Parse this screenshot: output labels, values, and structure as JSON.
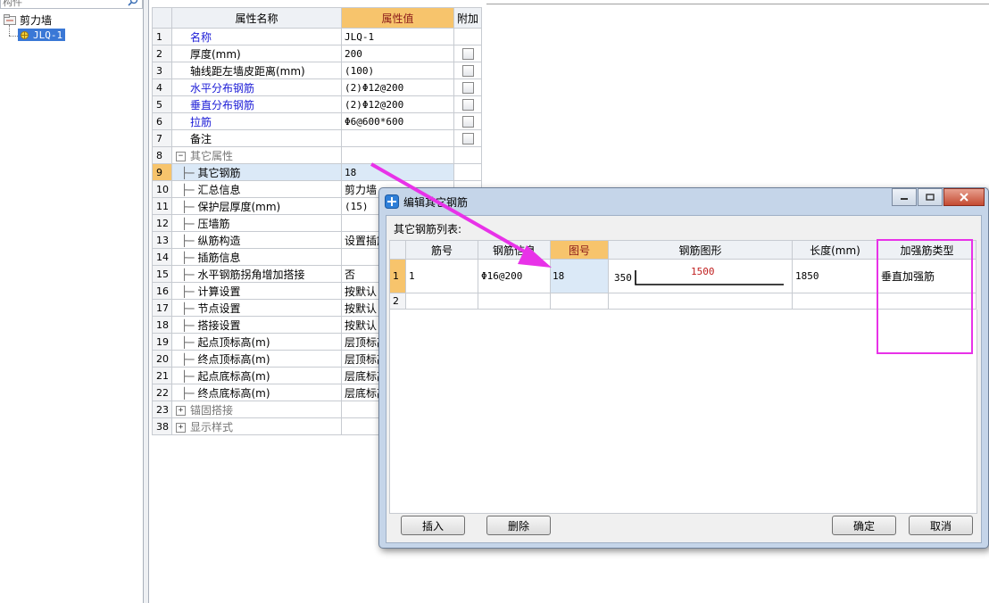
{
  "search": {
    "placeholder": "构件"
  },
  "tree": {
    "root_label": "剪力墙",
    "child_label": "JLQ-1"
  },
  "property_grid": {
    "headers": {
      "name": "属性名称",
      "value": "属性值",
      "add": "附加"
    },
    "rows": [
      {
        "num": "1",
        "name": "名称",
        "value": "JLQ-1",
        "blue": true,
        "checkbox": false
      },
      {
        "num": "2",
        "name": "厚度(mm)",
        "value": "200",
        "blue": false,
        "checkbox": true
      },
      {
        "num": "3",
        "name": "轴线距左墙皮距离(mm)",
        "value": "(100)",
        "blue": false,
        "checkbox": true
      },
      {
        "num": "4",
        "name": "水平分布钢筋",
        "value": "(2)Φ12@200",
        "blue": true,
        "checkbox": true
      },
      {
        "num": "5",
        "name": "垂直分布钢筋",
        "value": "(2)Φ12@200",
        "blue": true,
        "checkbox": true
      },
      {
        "num": "6",
        "name": "拉筋",
        "value": "Φ6@600*600",
        "blue": true,
        "checkbox": true
      },
      {
        "num": "7",
        "name": "备注",
        "value": "",
        "blue": false,
        "checkbox": true
      },
      {
        "num": "8",
        "name": "其它属性",
        "value": "",
        "group": true,
        "expander": "−"
      },
      {
        "num": "9",
        "name": "其它钢筋",
        "value": "18",
        "child": true,
        "selected": true
      },
      {
        "num": "10",
        "name": "汇总信息",
        "value": "剪力墙",
        "child": true
      },
      {
        "num": "11",
        "name": "保护层厚度(mm)",
        "value": "(15)",
        "child": true
      },
      {
        "num": "12",
        "name": "压墙筋",
        "value": "",
        "child": true
      },
      {
        "num": "13",
        "name": "纵筋构造",
        "value": "设置插筋",
        "child": true
      },
      {
        "num": "14",
        "name": "插筋信息",
        "value": "",
        "child": true
      },
      {
        "num": "15",
        "name": "水平钢筋拐角增加搭接",
        "value": "否",
        "child": true
      },
      {
        "num": "16",
        "name": "计算设置",
        "value": "按默认",
        "child": true
      },
      {
        "num": "17",
        "name": "节点设置",
        "value": "按默认",
        "child": true
      },
      {
        "num": "18",
        "name": "搭接设置",
        "value": "按默认",
        "child": true
      },
      {
        "num": "19",
        "name": "起点顶标高(m)",
        "value": "层顶标高",
        "child": true
      },
      {
        "num": "20",
        "name": "终点顶标高(m)",
        "value": "层顶标高",
        "child": true
      },
      {
        "num": "21",
        "name": "起点底标高(m)",
        "value": "层底标高",
        "child": true
      },
      {
        "num": "22",
        "name": "终点底标高(m)",
        "value": "层底标高",
        "child": true
      },
      {
        "num": "23",
        "name": "锚固搭接",
        "value": "",
        "group": true,
        "expander": "+"
      },
      {
        "num": "38",
        "name": "显示样式",
        "value": "",
        "group": true,
        "expander": "+"
      }
    ]
  },
  "dialog": {
    "title": "编辑其它钢筋",
    "list_label": "其它钢筋列表:",
    "columns": [
      "筋号",
      "钢筋信息",
      "图号",
      "钢筋图形",
      "长度(mm)",
      "加强筋类型"
    ],
    "rows": [
      {
        "num": "1",
        "bar_no": "1",
        "info": "Φ16@200",
        "fig": "18",
        "shape_left": "350",
        "shape_mid": "1500",
        "length": "1850",
        "type": "垂直加强筋"
      },
      {
        "num": "2",
        "bar_no": "",
        "info": "",
        "fig": "",
        "shape_left": "",
        "shape_mid": "",
        "length": "",
        "type": ""
      }
    ],
    "buttons": {
      "insert": "插入",
      "delete": "删除",
      "ok": "确定",
      "cancel": "取消"
    }
  },
  "colors": {
    "annotation": "#e832e8",
    "selection": "#3a78d6",
    "header_accent": "#f7c46c"
  }
}
